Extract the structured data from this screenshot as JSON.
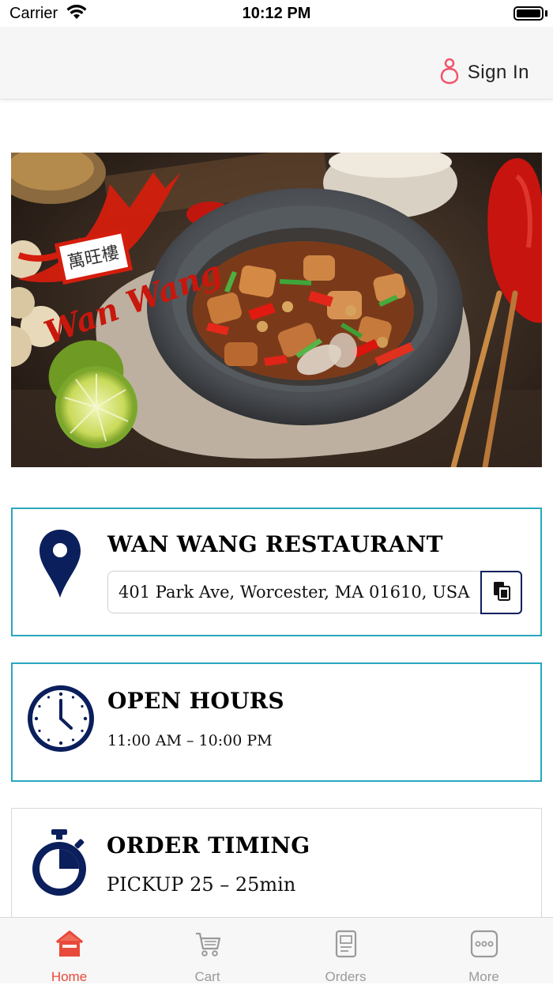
{
  "status_bar": {
    "carrier": "Carrier",
    "time": "10:12 PM",
    "battery_level": 1.0
  },
  "header": {
    "sign_in_label": "Sign In",
    "sign_in_icon": "person-icon",
    "accent_color": "#f1546a"
  },
  "hero": {
    "logo_chinese": "萬旺樓",
    "logo_name": "Wan Wang"
  },
  "location_card": {
    "icon": "map-pin-icon",
    "title": "WAN WANG RESTAURANT",
    "address": "401 Park Ave, Worcester, MA 01610, USA",
    "copy_icon": "copy-icon"
  },
  "hours_card": {
    "icon": "clock-icon",
    "title": "OPEN HOURS",
    "hours": "11:00 AM – 10:00 PM"
  },
  "timing_card": {
    "icon": "stopwatch-icon",
    "title": "ORDER TIMING",
    "pickup": "PICKUP 25 – 25min"
  },
  "tab_bar": {
    "active_color": "#e8493a",
    "inactive_color": "#9a9a9a",
    "tabs": [
      {
        "label": "Home",
        "icon": "home-icon",
        "active": true
      },
      {
        "label": "Cart",
        "icon": "cart-icon",
        "active": false
      },
      {
        "label": "Orders",
        "icon": "orders-icon",
        "active": false
      },
      {
        "label": "More",
        "icon": "more-icon",
        "active": false
      }
    ]
  },
  "colors": {
    "navy": "#0b1f5c",
    "teal_border": "#2aa7bf"
  }
}
